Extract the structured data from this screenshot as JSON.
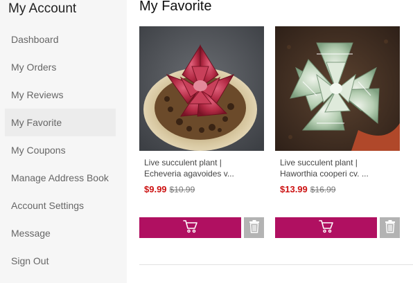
{
  "sidebar": {
    "title": "My Account",
    "items": [
      {
        "label": "Dashboard"
      },
      {
        "label": "My Orders"
      },
      {
        "label": "My Reviews"
      },
      {
        "label": "My Favorite",
        "active": true
      },
      {
        "label": "My Coupons"
      },
      {
        "label": "Manage Address Book"
      },
      {
        "label": "Account Settings"
      },
      {
        "label": "Message"
      },
      {
        "label": "Sign Out"
      }
    ]
  },
  "main": {
    "title": "My Favorite",
    "products": [
      {
        "name_line1": "Live succulent plant |",
        "name_line2": "Echeveria agavoides v...",
        "price": "$9.99",
        "old_price": "$10.99",
        "image": "red-echeveria-succulent"
      },
      {
        "name_line1": "Live succulent plant |",
        "name_line2": "Haworthia cooperi cv. ...",
        "price": "$13.99",
        "old_price": "$16.99",
        "image": "green-haworthia-succulent"
      }
    ]
  },
  "icons": {
    "cart": "shopping-cart-icon",
    "delete": "trash-icon"
  },
  "colors": {
    "accent": "#b01061",
    "price": "#cc1111",
    "delete_button": "#b3b3b3",
    "sidebar_bg": "#f6f6f6",
    "active_item_bg": "#ececec"
  }
}
